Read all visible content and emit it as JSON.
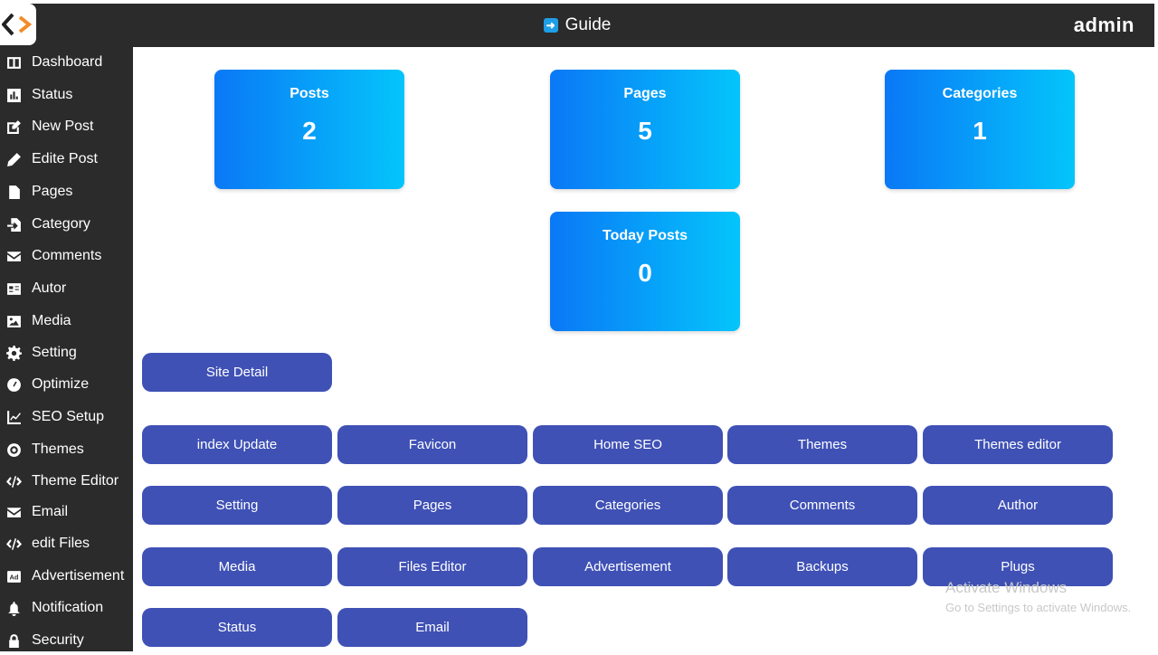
{
  "header": {
    "title": "Guide",
    "user": "admin",
    "guide_icon_name": "arrow-right-icon",
    "accent_color": "#1e9ee6"
  },
  "sidebar": {
    "items": [
      {
        "label": "Dashboard",
        "icon": "dashboard-icon"
      },
      {
        "label": "Status",
        "icon": "bar-chart-icon"
      },
      {
        "label": "New Post",
        "icon": "edit-square-icon"
      },
      {
        "label": "Edite Post",
        "icon": "pencil-icon"
      },
      {
        "label": "Pages",
        "icon": "file-icon"
      },
      {
        "label": "Category",
        "icon": "file-import-icon"
      },
      {
        "label": "Comments",
        "icon": "envelope-icon"
      },
      {
        "label": "Autor",
        "icon": "id-card-icon"
      },
      {
        "label": "Media",
        "icon": "image-icon"
      },
      {
        "label": "Setting",
        "icon": "gear-icon"
      },
      {
        "label": "Optimize",
        "icon": "gauge-icon"
      },
      {
        "label": "SEO Setup",
        "icon": "line-chart-icon"
      },
      {
        "label": "Themes",
        "icon": "eye-icon"
      },
      {
        "label": "Theme Editor",
        "icon": "code-icon"
      },
      {
        "label": "Email",
        "icon": "envelope-icon"
      },
      {
        "label": "edit Files",
        "icon": "code-icon"
      },
      {
        "label": "Advertisement",
        "icon": "ad-icon"
      },
      {
        "label": "Notification",
        "icon": "bell-icon"
      },
      {
        "label": "Security",
        "icon": "lock-icon"
      }
    ]
  },
  "stats": [
    {
      "title": "Posts",
      "value": "2"
    },
    {
      "title": "Pages",
      "value": "5"
    },
    {
      "title": "Categories",
      "value": "1"
    },
    {
      "title": "Today Posts",
      "value": "0"
    }
  ],
  "site_detail_label": "Site Detail",
  "buttons": [
    "index Update",
    "Favicon",
    "Home SEO",
    "Themes",
    "Themes editor",
    "Setting",
    "Pages",
    "Categories",
    "Comments",
    "Author",
    "Media",
    "Files Editor",
    "Advertisement",
    "Backups",
    "Plugs",
    "Status",
    "Email"
  ],
  "colors": {
    "sidebar_bg": "#2b2b2b",
    "button_bg": "#3f51b5",
    "card_gradient_start": "#0a78f6",
    "card_gradient_end": "#04c5fb"
  },
  "watermark": {
    "title": "Activate Windows",
    "subtitle": "Go to Settings to activate Windows."
  }
}
